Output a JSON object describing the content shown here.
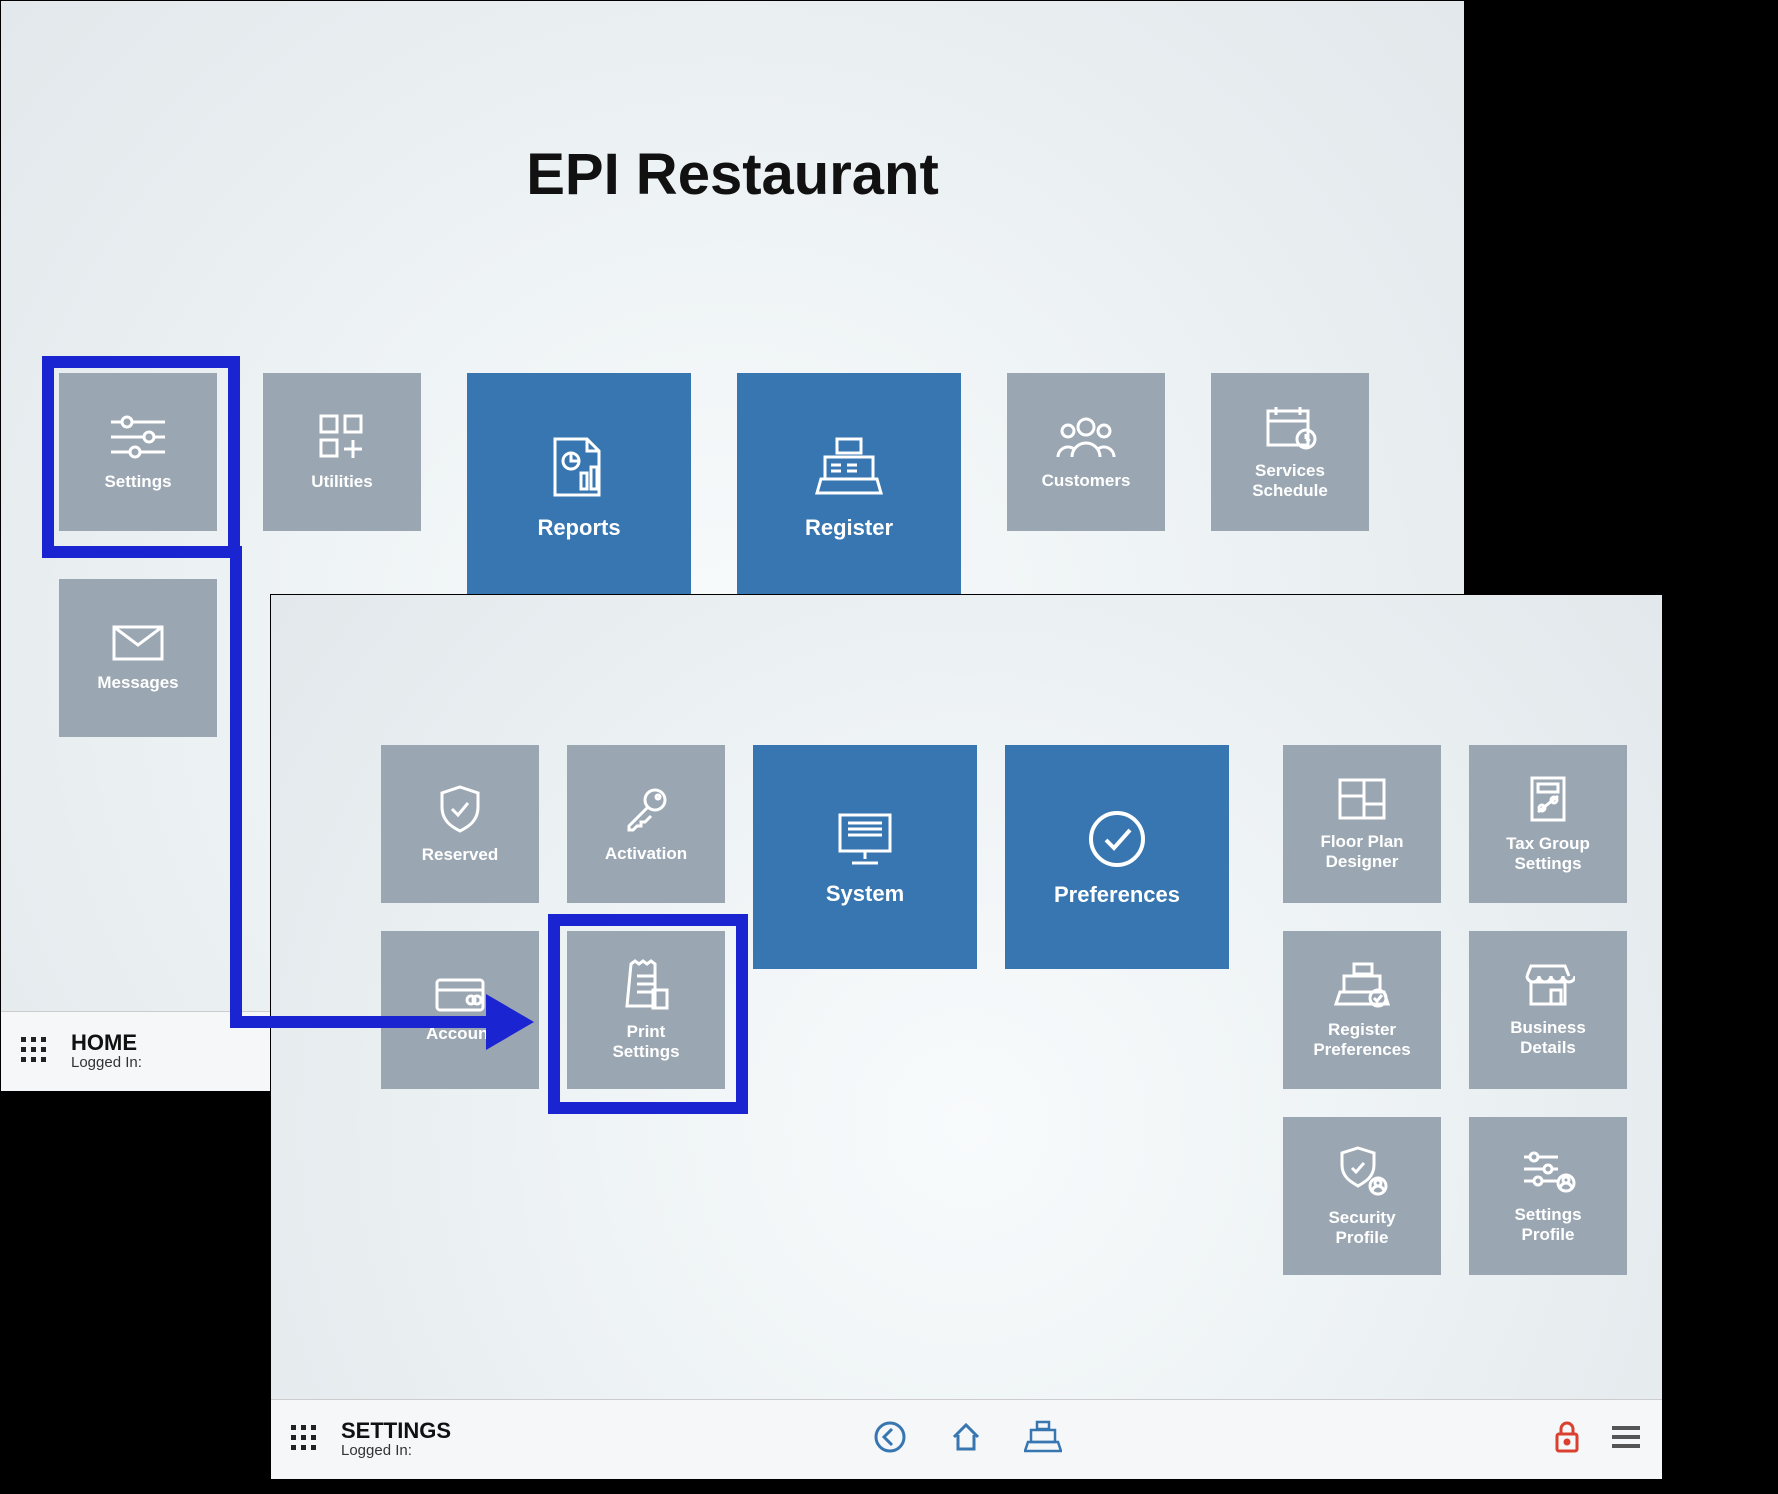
{
  "home": {
    "title": "EPI Restaurant",
    "tiles": {
      "settings": "Settings",
      "utilities": "Utilities",
      "reports": "Reports",
      "register": "Register",
      "customers": "Customers",
      "services_schedule": "Services\nSchedule",
      "messages": "Messages"
    },
    "bottombar": {
      "section": "HOME",
      "logged_in_label": "Logged In:"
    }
  },
  "settings": {
    "tiles": {
      "reserved": "Reserved",
      "activation": "Activation",
      "system": "System",
      "preferences": "Preferences",
      "floor_plan_designer": "Floor Plan\nDesigner",
      "tax_group_settings": "Tax Group\nSettings",
      "account": "Account",
      "print_settings": "Print\nSettings",
      "register_preferences": "Register\nPreferences",
      "business_details": "Business\nDetails",
      "security_profile": "Security\nProfile",
      "settings_profile": "Settings\nProfile"
    },
    "bottombar": {
      "section": "SETTINGS",
      "logged_in_label": "Logged In:"
    }
  },
  "colors": {
    "highlight": "#1a24d0",
    "tile_grey": "#9aa6b1",
    "tile_blue": "#3776b0"
  }
}
